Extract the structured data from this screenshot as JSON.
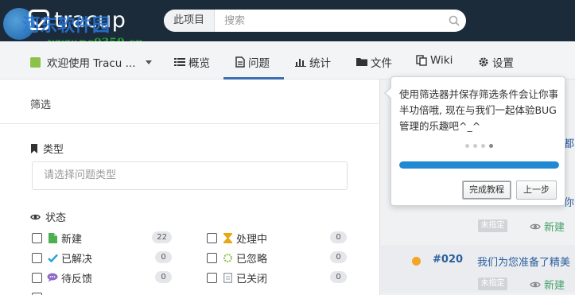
{
  "header": {
    "logo_text": "tracup",
    "scope_label": "此项目",
    "search_placeholder": "搜索"
  },
  "watermark": {
    "text": "河东软件园",
    "url": "www.pc0359.cn"
  },
  "nav": {
    "project_name": "欢迎使用 Tracu ...",
    "items": [
      {
        "label": "概览",
        "icon": "list-icon"
      },
      {
        "label": "问题",
        "icon": "issue-icon",
        "active": true
      },
      {
        "label": "统计",
        "icon": "bar-chart-icon"
      },
      {
        "label": "文件",
        "icon": "folder-icon"
      },
      {
        "label": "Wiki",
        "icon": "copy-icon"
      },
      {
        "label": "设置",
        "icon": "gear-icon"
      }
    ]
  },
  "filter": {
    "title": "筛选",
    "type_label": "类型",
    "type_placeholder": "请选择问题类型",
    "status_label": "状态",
    "statuses": [
      {
        "label": "新建",
        "count": "22",
        "icon": "file-icon",
        "color": "#4caf50"
      },
      {
        "label": "处理中",
        "count": "0",
        "icon": "hourglass-icon",
        "color": "#e6a817"
      },
      {
        "label": "已解决",
        "count": "0",
        "icon": "check-icon",
        "color": "#2a9fd6"
      },
      {
        "label": "已忽略",
        "count": "0",
        "icon": "sun-icon",
        "color": "#8bc34a"
      },
      {
        "label": "待反馈",
        "count": "0",
        "icon": "chat-icon",
        "color": "#8e6cc9"
      },
      {
        "label": "已关闭",
        "count": "0",
        "icon": "closed-icon",
        "color": "#9aa0a6"
      }
    ]
  },
  "issues": [
    {
      "assignee": "未指定",
      "status": "新建"
    },
    {
      "id": "#020",
      "title": "我们为您准备了精美",
      "assignee": "未指定",
      "status": "新建",
      "priority_color": "#f5a623"
    }
  ],
  "content_fragments": [
    "都",
    "你"
  ],
  "tutorial": {
    "text": "使用筛选器并保存筛选条件会让你事半功倍哦, 现在与我们一起体验BUG管理的乐趣吧^_^",
    "step": 4,
    "total_steps": 4,
    "progress": 1.0,
    "finish_label": "完成教程",
    "prev_label": "上一步"
  },
  "colors": {
    "header_bg": "#1c2b3a",
    "accent": "#3a6fb0",
    "progress": "#1f8ad2",
    "new_status": "#46a36b"
  }
}
